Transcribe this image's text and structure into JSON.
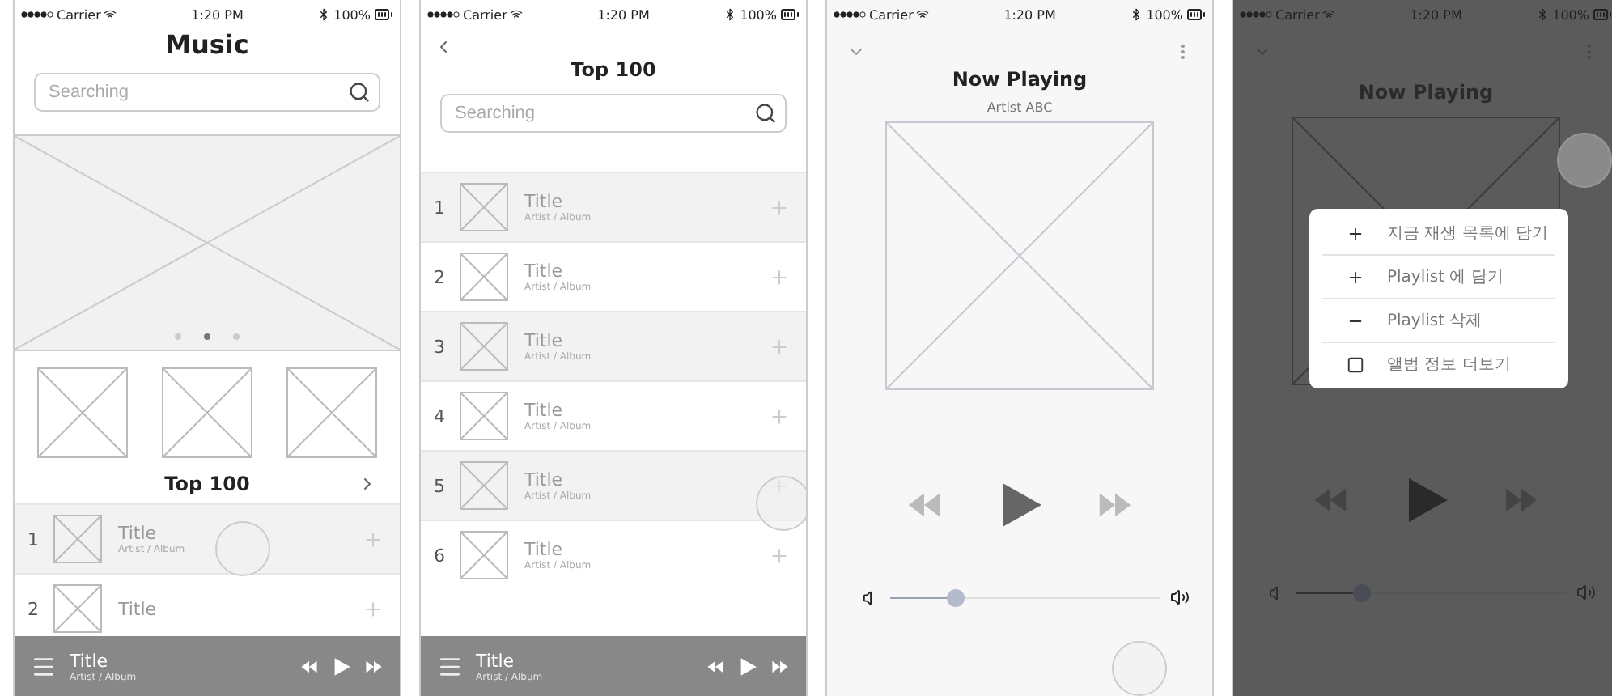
{
  "screens": [
    {
      "kind": "home",
      "status": {
        "carrier": "Carrier",
        "time": "1:20 PM",
        "battery": "100%"
      },
      "title": "Music",
      "search": {
        "placeholder": "Searching"
      },
      "carousel_dots": [
        {
          "selected": false
        },
        {
          "selected": true
        },
        {
          "selected": false
        }
      ],
      "section": {
        "title": "Top 100"
      },
      "tracks": [
        {
          "rank": "1",
          "title": "Title",
          "subtitle": "Artist / Album"
        },
        {
          "rank": "2",
          "title": "Title"
        }
      ],
      "mini_player": {
        "title": "Title",
        "subtitle": "Artist / Album"
      }
    },
    {
      "kind": "list",
      "status": {
        "carrier": "Carrier",
        "time": "1:20 PM",
        "battery": "100%"
      },
      "title": "Top 100",
      "search": {
        "placeholder": "Searching"
      },
      "tracks": [
        {
          "rank": "1",
          "title": "Title",
          "subtitle": "Artist / Album"
        },
        {
          "rank": "2",
          "title": "Title",
          "subtitle": "Artist / Album"
        },
        {
          "rank": "3",
          "title": "Title",
          "subtitle": "Artist / Album"
        },
        {
          "rank": "4",
          "title": "Title",
          "subtitle": "Artist / Album"
        },
        {
          "rank": "5",
          "title": "Title",
          "subtitle": "Artist / Album"
        },
        {
          "rank": "6",
          "title": "Title",
          "subtitle": "Artist / Album"
        }
      ],
      "mini_player": {
        "title": "Title",
        "subtitle": "Artist / Album"
      }
    },
    {
      "kind": "player",
      "status": {
        "carrier": "Carrier",
        "time": "1:20 PM",
        "battery": "100%"
      },
      "title": "Now Playing",
      "artist": "Artist ABC",
      "volume": {
        "level": 0.22
      }
    },
    {
      "kind": "player_menu",
      "status": {
        "carrier": "Carrier",
        "time": "1:20 PM",
        "battery": "100%"
      },
      "title": "Now Playing",
      "volume": {
        "level": 0.22
      },
      "menu": [
        {
          "kind": "plus",
          "label": "지금 재생 목록에 담기"
        },
        {
          "kind": "plus",
          "label": "Playlist 에 담기"
        },
        {
          "kind": "minus",
          "label": "Playlist 삭제"
        },
        {
          "kind": "square",
          "label": "앨범 정보 더보기"
        }
      ]
    }
  ]
}
